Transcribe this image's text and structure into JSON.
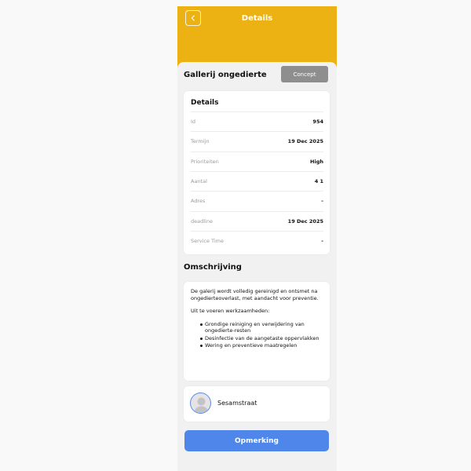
{
  "header": {
    "title": "Details",
    "back_icon": "chevron-left-icon",
    "background_color": "#ecb112"
  },
  "item": {
    "title": "Gallerij ongedierte",
    "status_label": "Concept"
  },
  "details": {
    "title": "Details",
    "rows": [
      {
        "label": "Id",
        "value": "954"
      },
      {
        "label": "Termijn",
        "value": "19 Dec 2025"
      },
      {
        "label": "Prioriteiten",
        "value": "High"
      },
      {
        "label": "Aantal",
        "value": "4 1"
      },
      {
        "label": "Adres",
        "value": "-"
      },
      {
        "label": "deadline",
        "value": "19 Dec 2025"
      },
      {
        "label": "Service Time",
        "value": "-"
      }
    ]
  },
  "description": {
    "title": "Omschrijving",
    "intro": "De galerij wordt volledig gereinigd en ontsmet na ongedierteoverlast, met aandacht voor preventie.",
    "tasks_heading": "Uit te voeren werkzaamheden:",
    "tasks": [
      "Grondige reiniging en verwijdering van ongedierte-resten",
      "Desinfectie van de aangetaste oppervlakken",
      "Wering en preventieve maatregelen"
    ]
  },
  "person": {
    "name": "Sesamstraat",
    "avatar_icon": "user-avatar-icon"
  },
  "footer": {
    "button_label": "Opmerking",
    "button_color": "#4f86ea"
  }
}
